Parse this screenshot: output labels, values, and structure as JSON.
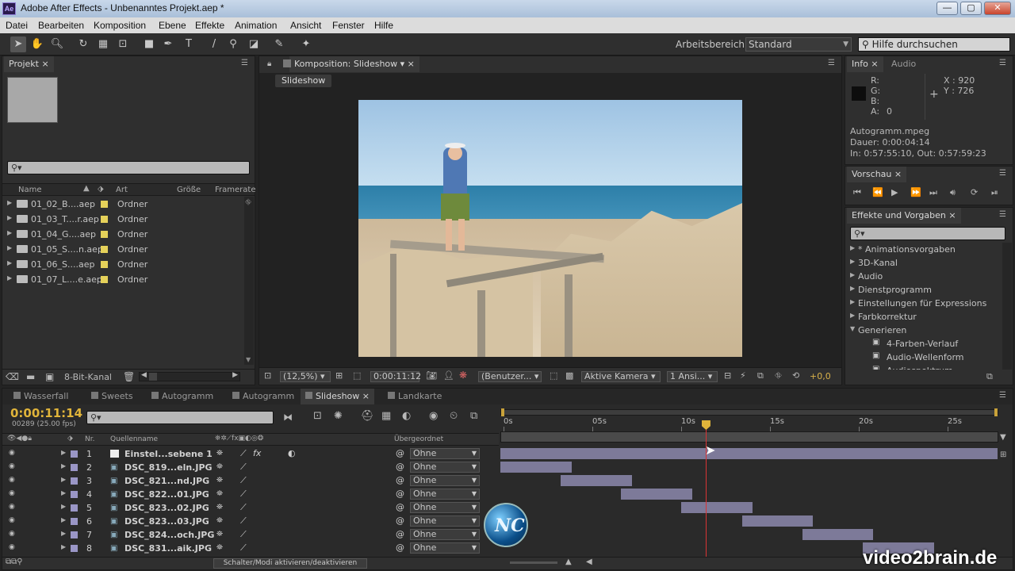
{
  "window": {
    "app_badge": "Ae",
    "title": "Adobe After Effects - Unbenanntes Projekt.aep *",
    "minimize": "—",
    "maximize": "▢",
    "close": "✕"
  },
  "menu": [
    "Datei",
    "Bearbeiten",
    "Komposition",
    "Ebene",
    "Effekte",
    "Animation",
    "Ansicht",
    "Fenster",
    "Hilfe"
  ],
  "toolbar": {
    "workspace_label": "Arbeitsbereich:",
    "workspace_value": "Standard",
    "help_placeholder": "Hilfe durchsuchen"
  },
  "project": {
    "tab": "Projekt",
    "columns": [
      "Name",
      "Art",
      "Größe",
      "Framerate"
    ],
    "items": [
      {
        "name": "01_02_B....aep",
        "type": "Ordner"
      },
      {
        "name": "01_03_T....r.aep",
        "type": "Ordner"
      },
      {
        "name": "01_04_G....aep",
        "type": "Ordner"
      },
      {
        "name": "01_05_S....n.aep",
        "type": "Ordner"
      },
      {
        "name": "01_06_S....aep",
        "type": "Ordner"
      },
      {
        "name": "01_07_L....e.aep",
        "type": "Ordner"
      }
    ],
    "bit_depth": "8-Bit-Kanal"
  },
  "composition": {
    "tab": "Komposition: Slideshow",
    "breadcrumb": "Slideshow",
    "zoom": "(12,5%)",
    "timecode": "0:00:11:12",
    "resolution": "(Benutzer...",
    "camera": "Aktive Kamera",
    "views": "1 Ansi...",
    "exposure": "+0,0"
  },
  "info": {
    "tab_info": "Info",
    "tab_audio": "Audio",
    "r": "R:",
    "g": "G:",
    "b": "B:",
    "a": "A:",
    "a_val": "0",
    "x": "X : 920",
    "y": "Y : 726",
    "file": "Autogramm.mpeg",
    "duration": "Dauer: 0:00:04:14",
    "inout": "In: 0:57:55:10, Out: 0:57:59:23"
  },
  "preview": {
    "tab": "Vorschau"
  },
  "effects": {
    "tab": "Effekte und Vorgaben",
    "items": [
      {
        "label": "* Animationsvorgaben",
        "expanded": false
      },
      {
        "label": "3D-Kanal",
        "expanded": false
      },
      {
        "label": "Audio",
        "expanded": false
      },
      {
        "label": "Dienstprogramm",
        "expanded": false
      },
      {
        "label": "Einstellungen für Expressions",
        "expanded": false
      },
      {
        "label": "Farbkorrektur",
        "expanded": false
      },
      {
        "label": "Generieren",
        "expanded": true
      }
    ],
    "children": [
      "4-Farben-Verlauf",
      "Audio-Wellenform",
      "Audiospektrum"
    ]
  },
  "timeline": {
    "tabs": [
      "Wasserfall",
      "Sweets",
      "Autogramm",
      "Autogramm",
      "Slideshow",
      "Landkarte"
    ],
    "active_tab": 4,
    "current_time": "0:00:11:14",
    "frame_info": "00289 (25.00 fps)",
    "col_nr": "Nr.",
    "col_source": "Quellenname",
    "col_parent": "Übergeordnet",
    "ruler": [
      "0s",
      "05s",
      "10s",
      "15s",
      "20s",
      "25s"
    ],
    "layers": [
      {
        "nr": "1",
        "name": "Einstel...sebene 1",
        "parent": "Ohne",
        "start": 0,
        "end": 28
      },
      {
        "nr": "2",
        "name": "DSC_819...eln.JPG",
        "parent": "Ohne",
        "start": 0,
        "end": 4
      },
      {
        "nr": "3",
        "name": "DSC_821...nd.JPG",
        "parent": "Ohne",
        "start": 3.4,
        "end": 7.4
      },
      {
        "nr": "4",
        "name": "DSC_822...01.JPG",
        "parent": "Ohne",
        "start": 6.8,
        "end": 10.8
      },
      {
        "nr": "5",
        "name": "DSC_823...02.JPG",
        "parent": "Ohne",
        "start": 10.2,
        "end": 14.2
      },
      {
        "nr": "6",
        "name": "DSC_823...03.JPG",
        "parent": "Ohne",
        "start": 13.6,
        "end": 17.6
      },
      {
        "nr": "7",
        "name": "DSC_824...och.JPG",
        "parent": "Ohne",
        "start": 17,
        "end": 21
      },
      {
        "nr": "8",
        "name": "DSC_831...aik.JPG",
        "parent": "Ohne",
        "start": 20.4,
        "end": 24.4
      }
    ],
    "switch_label": "Schalter/Modi aktivieren/deaktivieren"
  },
  "watermark": "video2brain.de"
}
